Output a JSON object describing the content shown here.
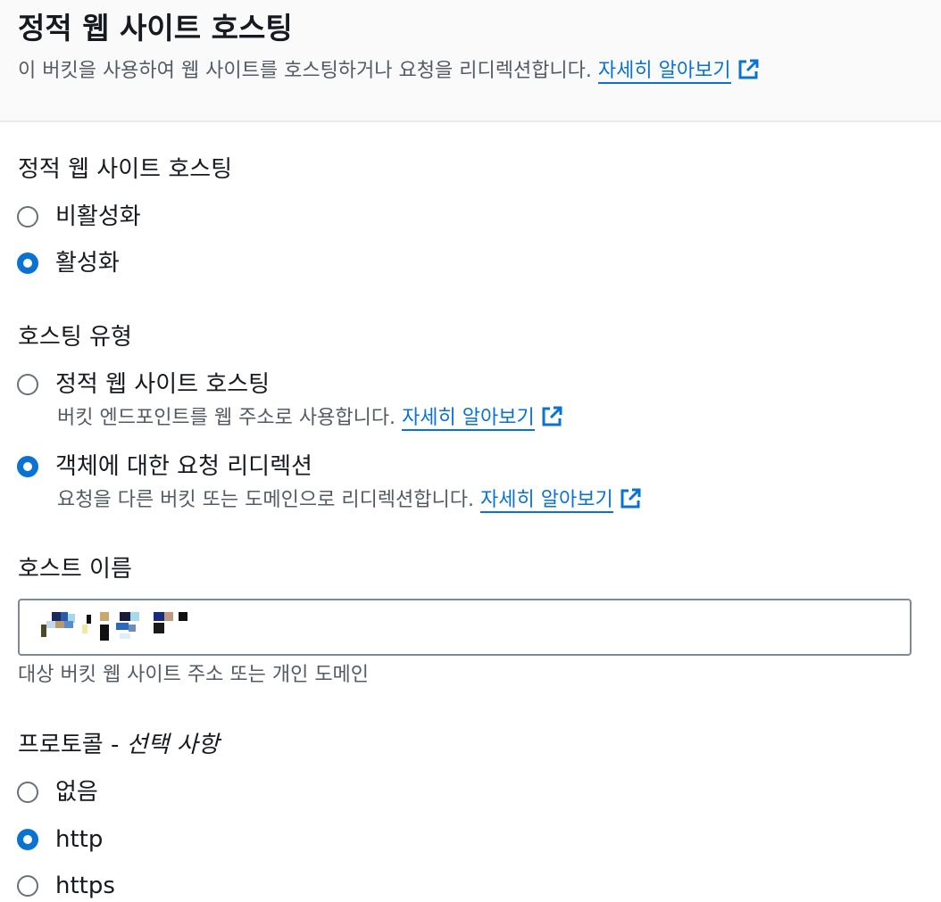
{
  "header": {
    "title": "정적 웹 사이트 호스팅",
    "description": "이 버킷을 사용하여 웹 사이트를 호스팅하거나 요청을 리디렉션합니다.",
    "learn_more": "자세히 알아보기",
    "learn_more_icon": "external-link-icon"
  },
  "static_hosting": {
    "label": "정적 웹 사이트 호스팅",
    "options": [
      {
        "label": "비활성화",
        "selected": false
      },
      {
        "label": "활성화",
        "selected": true
      }
    ]
  },
  "hosting_type": {
    "label": "호스팅 유형",
    "options": [
      {
        "label": "정적 웹 사이트 호스팅",
        "description": "버킷 엔드포인트를 웹 주소로 사용합니다.",
        "learn_more": "자세히 알아보기",
        "selected": false
      },
      {
        "label": "객체에 대한 요청 리디렉션",
        "description": "요청을 다른 버킷 또는 도메인으로 리디렉션합니다.",
        "learn_more": "자세히 알아보기",
        "selected": true
      }
    ]
  },
  "host_name": {
    "label": "호스트 이름",
    "value": "",
    "hint": "대상 버킷 웹 사이트 주소 또는 개인 도메인"
  },
  "protocol": {
    "label": "프로토콜 -",
    "optional": "선택 사항",
    "options": [
      {
        "label": "없음",
        "selected": false
      },
      {
        "label": "http",
        "selected": true
      },
      {
        "label": "https",
        "selected": false
      }
    ]
  },
  "colors": {
    "accent": "#0972d3",
    "text": "#16191f",
    "secondary_text": "#545b64",
    "header_bg": "#fafafa",
    "input_border": "#7d8998"
  }
}
